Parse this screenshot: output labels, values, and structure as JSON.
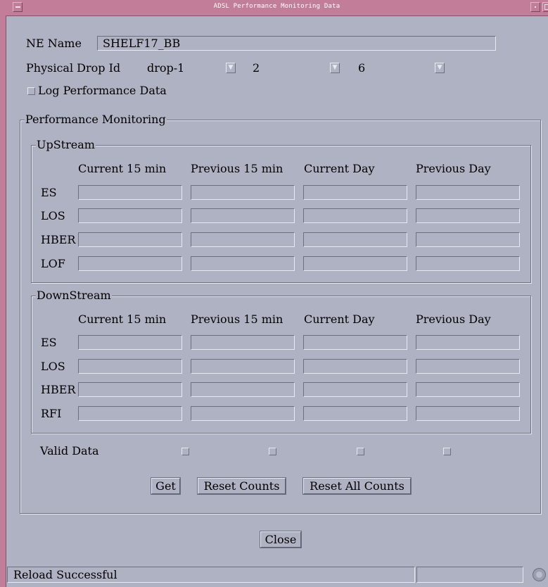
{
  "window": {
    "title": "ADSL Performance Monitoring Data"
  },
  "ne_name": {
    "label": "NE Name",
    "value": "SHELF17_BB"
  },
  "physical_drop": {
    "label": "Physical Drop Id",
    "drop": "drop-1",
    "value2": "2",
    "value3": "6"
  },
  "log_performance": {
    "label": "Log Performance Data",
    "checked": false
  },
  "performance": {
    "title": "Performance Monitoring",
    "columns": [
      "Current 15 min",
      "Previous 15 min",
      "Current Day",
      "Previous Day"
    ],
    "upstream": {
      "title": "UpStream",
      "rows": [
        "ES",
        "LOS",
        "HBER",
        "LOF"
      ]
    },
    "downstream": {
      "title": "DownStream",
      "rows": [
        "ES",
        "LOS",
        "HBER",
        "RFI"
      ]
    },
    "valid_data_label": "Valid Data"
  },
  "buttons": {
    "get": "Get",
    "reset_counts": "Reset Counts",
    "reset_all_counts": "Reset All Counts",
    "close": "Close"
  },
  "status": {
    "message": "Reload Successful"
  },
  "colors": {
    "background": "#aeb2c3",
    "titlebar": "#c27e98"
  }
}
